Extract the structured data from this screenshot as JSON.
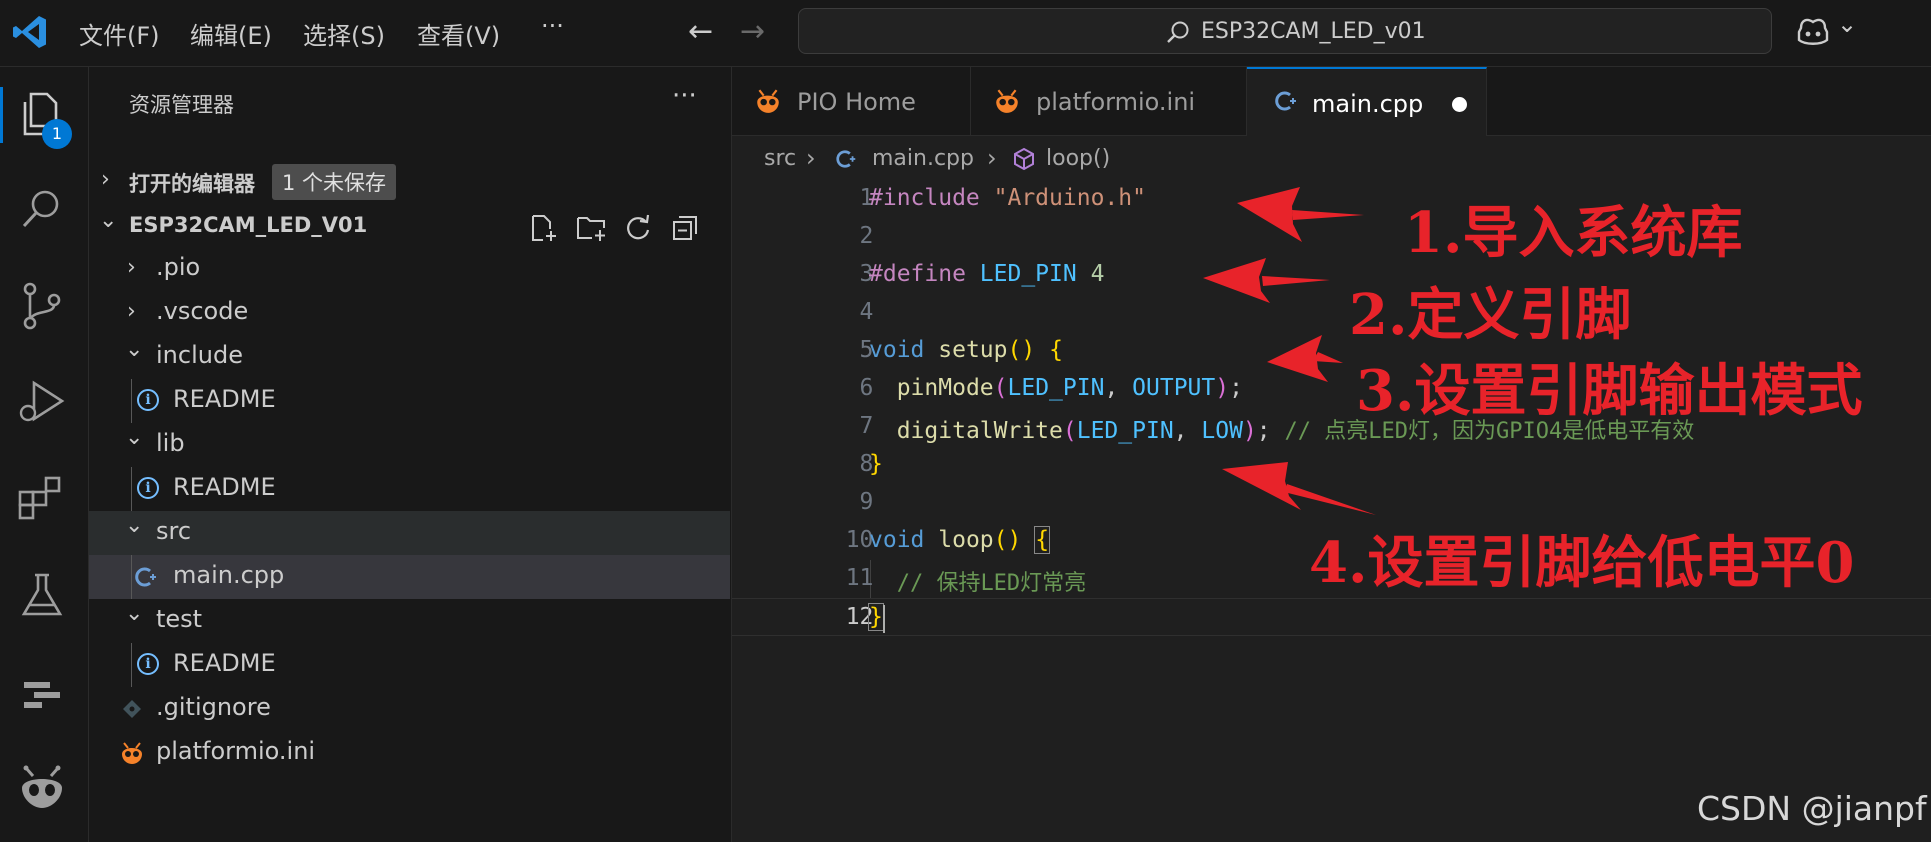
{
  "titlebar": {
    "menus": [
      "文件(F)",
      "编辑(E)",
      "选择(S)",
      "查看(V)"
    ],
    "more": "···",
    "back_arrow": "←",
    "forward_arrow": "→",
    "search_text": "ESP32CAM_LED_v01",
    "copilot_chevron": "⌄"
  },
  "activity": {
    "explorer_badge": "1"
  },
  "sidebar": {
    "title": "资源管理器",
    "more": "···",
    "open_editors": "打开的编辑器",
    "unsaved": "1 个未保存",
    "project": "ESP32CAM_LED_V01",
    "tree": [
      {
        "label": ".pio",
        "type": "folder-closed"
      },
      {
        "label": ".vscode",
        "type": "folder-closed"
      },
      {
        "label": "include",
        "type": "folder-open"
      },
      {
        "label": "README",
        "type": "info-file"
      },
      {
        "label": "lib",
        "type": "folder-open"
      },
      {
        "label": "README",
        "type": "info-file"
      },
      {
        "label": "src",
        "type": "folder-open"
      },
      {
        "label": "main.cpp",
        "type": "cpp-file"
      },
      {
        "label": "test",
        "type": "folder-open"
      },
      {
        "label": "README",
        "type": "info-file"
      },
      {
        "label": ".gitignore",
        "type": "git-file"
      },
      {
        "label": "platformio.ini",
        "type": "pio-file"
      }
    ]
  },
  "tabs": [
    {
      "label": "PIO Home"
    },
    {
      "label": "platformio.ini"
    },
    {
      "label": "main.cpp"
    }
  ],
  "breadcrumb": {
    "folder": "src",
    "file": "main.cpp",
    "symbol": "loop()"
  },
  "editor": {
    "line_numbers": [
      "1",
      "2",
      "3",
      "4",
      "5",
      "6",
      "7",
      "8",
      "9",
      "10",
      "11",
      "12"
    ],
    "tokens": {
      "l1_pp": "#include",
      "l1_str": "\"Arduino.h\"",
      "l3_pp": "#define",
      "l3_mac": "LED_PIN",
      "l3_num": "4",
      "l5_kw": "void",
      "l5_fn": "setup",
      "l5_paren": "()",
      "l5_brace": "{",
      "l6_fn": "pinMode",
      "l6_open": "(",
      "l6_arg1": "LED_PIN",
      "l6_comma": ",",
      "l6_arg2": "OUTPUT",
      "l6_close": ")",
      "l6_semi": ";",
      "l7_fn": "digitalWrite",
      "l7_open": "(",
      "l7_arg1": "LED_PIN",
      "l7_comma": ",",
      "l7_arg2": "LOW",
      "l7_close": ")",
      "l7_semi": ";",
      "l7_comment": "// 点亮LED灯，因为GPIO4是低电平有效",
      "l8_brace": "}",
      "l10_kw": "void",
      "l10_fn": "loop",
      "l10_paren": "()",
      "l10_brace": "{",
      "l11_comment": "// 保持LED灯常亮",
      "l12_brace": "}"
    }
  },
  "annotations": [
    {
      "text": "1.导入系统库",
      "color": "#e8232a"
    },
    {
      "text": "2.定义引脚",
      "color": "#e8232a"
    },
    {
      "text": "3.设置引脚输出模式",
      "color": "#e8232a"
    },
    {
      "text": "4.设置引脚给低电平0",
      "color": "#e8232a"
    }
  ],
  "watermark": "CSDN @jianpf"
}
